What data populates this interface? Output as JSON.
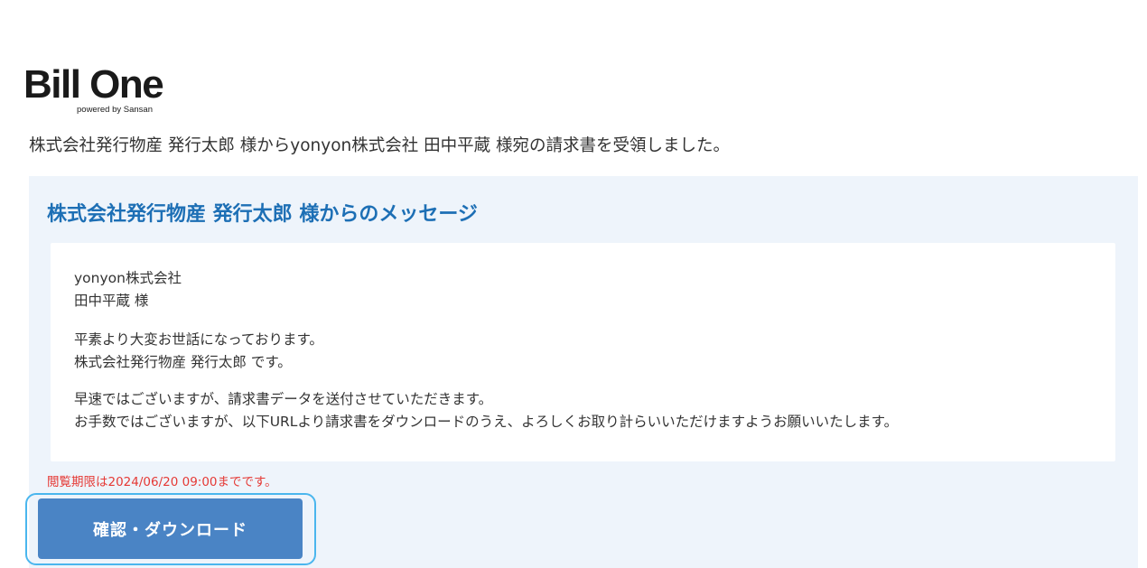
{
  "logo": {
    "text": "Bill One",
    "sub": "powered by Sansan"
  },
  "intro_text": "株式会社発行物産 発行太郎 様からyonyon株式会社 田中平蔵 様宛の請求書を受領しました。",
  "panel": {
    "title": "株式会社発行物産 発行太郎 様からのメッセージ",
    "message": {
      "line1": "yonyon株式会社",
      "line2": "田中平蔵 様",
      "line3": "平素より大変お世話になっております。",
      "line4": "株式会社発行物産 発行太郎 です。",
      "line5": "早速ではございますが、請求書データを送付させていただきます。",
      "line6": "お手数ではございますが、以下URLより請求書をダウンロードのうえ、よろしくお取り計らいいただけますようお願いいたします。"
    },
    "deadline": "閲覧期限は2024/06/20 09:00までです。",
    "button_label": "確認・ダウンロード"
  },
  "colors": {
    "accent": "#1d6fb5",
    "panel_bg": "#eef4fb",
    "button": "#4a84c5",
    "button_outline": "#4ab6ee",
    "deadline": "#e53935"
  }
}
